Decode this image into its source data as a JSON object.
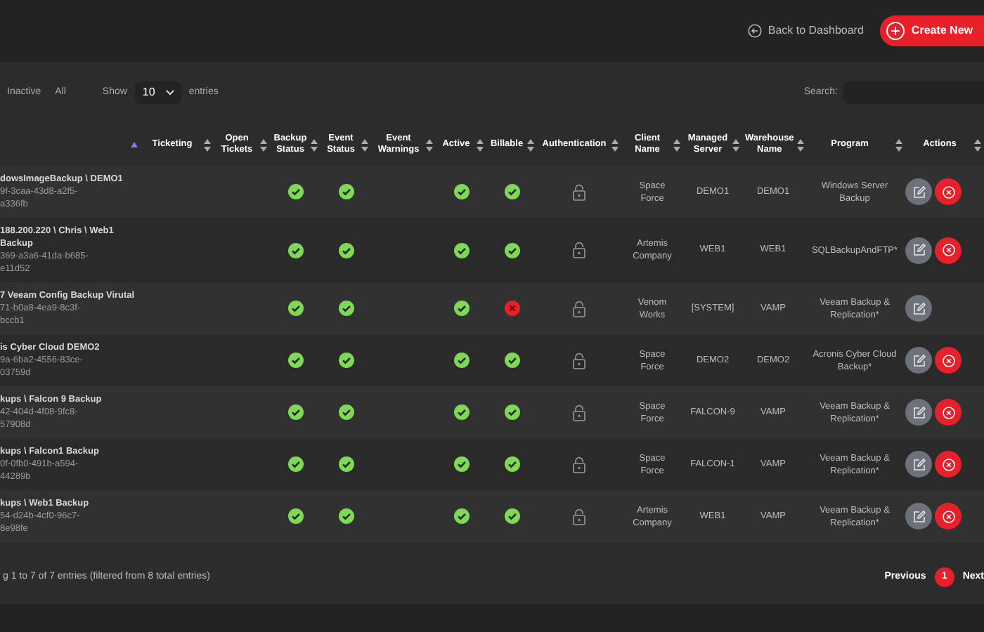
{
  "topbar": {
    "back_link": "Back to Dashboard",
    "create_button": "Create New"
  },
  "filters": [
    "Inactive",
    "All"
  ],
  "length_menu": {
    "before": "Show",
    "value": "10",
    "after": "entries"
  },
  "search": {
    "label": "Search:"
  },
  "table": {
    "columns": [
      "",
      "Ticketing",
      "Open Tickets",
      "Backup Status",
      "Event Status",
      "Event Warnings",
      "Active",
      "Billable",
      "Authentication",
      "Client Name",
      "Managed Server",
      "Warehouse Name",
      "Program",
      "Actions"
    ],
    "rows": [
      {
        "title": "dowsImageBackup \\ DEMO1",
        "id_lines": [
          "9f-3caa-43d8-a2f5-",
          "a336fb"
        ],
        "backup_ok": true,
        "event_ok": true,
        "active": true,
        "billable": true,
        "client": "Space Force",
        "server": "DEMO1",
        "warehouse": "DEMO1",
        "program": "Windows Server Backup",
        "deletable": true
      },
      {
        "title": "188.200.220 \\ Chris \\ Web1 Backup",
        "id_lines": [
          "369-a3a6-41da-b685-",
          "e11d52"
        ],
        "backup_ok": true,
        "event_ok": true,
        "active": true,
        "billable": true,
        "client": "Artemis Company",
        "server": "WEB1",
        "warehouse": "WEB1",
        "program": "SQLBackupAndFTP*",
        "deletable": true
      },
      {
        "title": "7 Veeam Config Backup Virutal",
        "id_lines": [
          "71-b0a8-4ea9-8c3f-",
          "bccb1"
        ],
        "backup_ok": true,
        "event_ok": true,
        "active": true,
        "billable": false,
        "client": "Venom Works",
        "server": "[SYSTEM]",
        "warehouse": "VAMP",
        "program": "Veeam Backup & Replication*",
        "deletable": false
      },
      {
        "title": "is Cyber Cloud DEMO2",
        "id_lines": [
          "9a-6ba2-4556-83ce-",
          "03759d"
        ],
        "backup_ok": true,
        "event_ok": true,
        "active": true,
        "billable": true,
        "client": "Space Force",
        "server": "DEMO2",
        "warehouse": "DEMO2",
        "program": "Acronis Cyber Cloud Backup*",
        "deletable": true
      },
      {
        "title": "kups \\ Falcon 9 Backup",
        "id_lines": [
          "42-404d-4f08-9fc8-",
          "57908d"
        ],
        "backup_ok": true,
        "event_ok": true,
        "active": true,
        "billable": true,
        "client": "Space Force",
        "server": "FALCON-9",
        "warehouse": "VAMP",
        "program": "Veeam Backup & Replication*",
        "deletable": true
      },
      {
        "title": "kups \\ Falcon1 Backup",
        "id_lines": [
          "0f-0fb0-491b-a594-",
          "44289b"
        ],
        "backup_ok": true,
        "event_ok": true,
        "active": true,
        "billable": true,
        "client": "Space Force",
        "server": "FALCON-1",
        "warehouse": "VAMP",
        "program": "Veeam Backup & Replication*",
        "deletable": true
      },
      {
        "title": "kups \\ Web1 Backup",
        "id_lines": [
          "54-d24b-4cf0-96c7-",
          "8e98fe"
        ],
        "backup_ok": true,
        "event_ok": true,
        "active": true,
        "billable": true,
        "client": "Artemis Company",
        "server": "WEB1",
        "warehouse": "VAMP",
        "program": "Veeam Backup & Replication*",
        "deletable": true
      }
    ]
  },
  "footer": {
    "info": "g 1 to 7 of 7 entries (filtered from 8 total entries)",
    "previous": "Previous",
    "pages": [
      {
        "label": "1",
        "selected": true
      }
    ],
    "next": "Next"
  }
}
